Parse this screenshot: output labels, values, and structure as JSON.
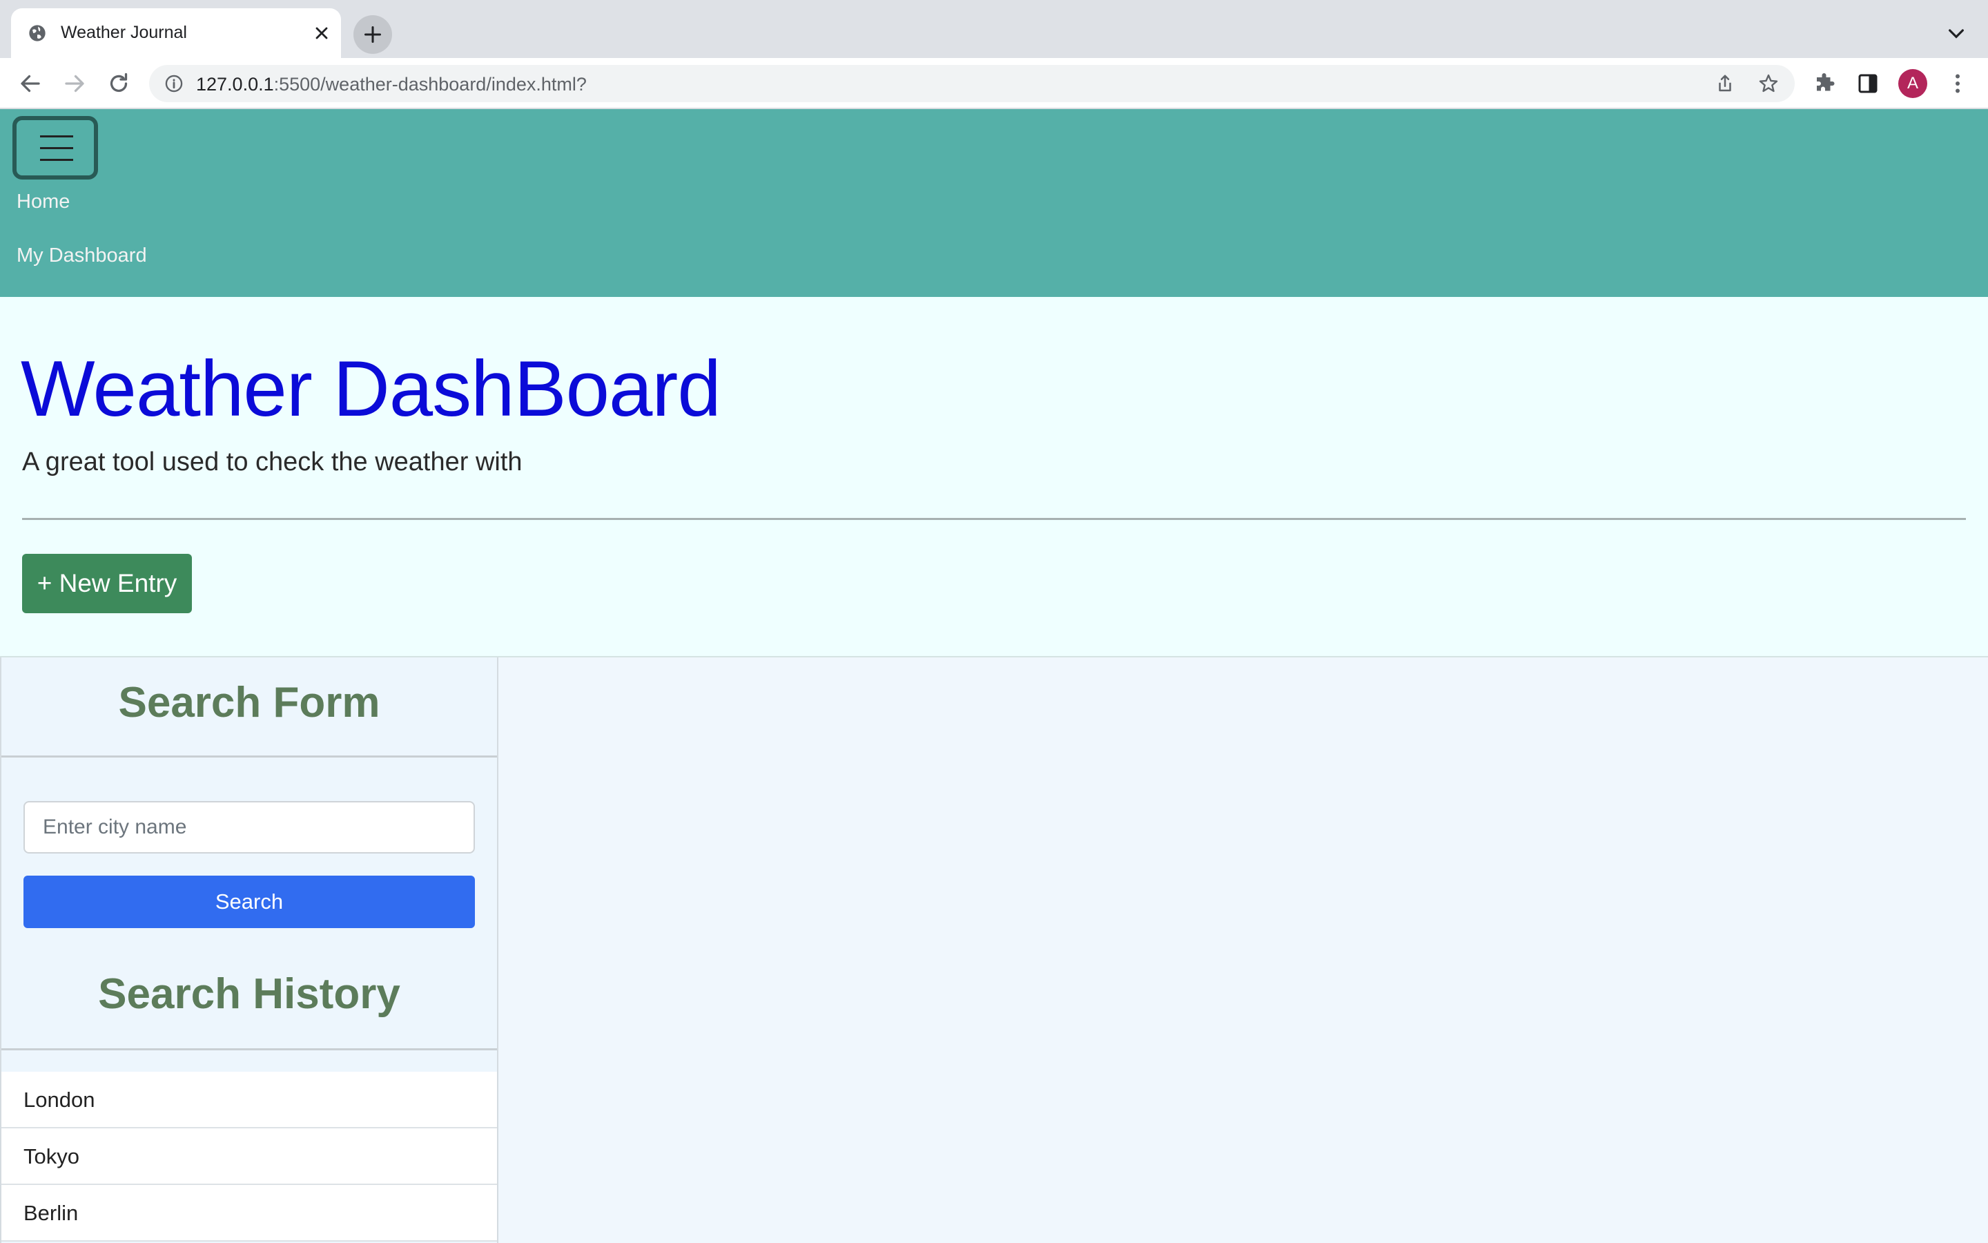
{
  "browser": {
    "tab_title": "Weather Journal",
    "url_host": "127.0.0.1",
    "url_rest": ":5500/weather-dashboard/index.html?",
    "avatar_letter": "A"
  },
  "navbar": {
    "links": [
      "Home",
      "My Dashboard"
    ]
  },
  "hero": {
    "title": "Weather DashBoard",
    "lead": "A great tool used to check the weather with",
    "new_entry_label": "+ New Entry"
  },
  "search_form": {
    "title": "Search Form",
    "placeholder": "Enter city name",
    "button_label": "Search"
  },
  "search_history": {
    "title": "Search History",
    "items": [
      "London",
      "Tokyo",
      "Berlin"
    ]
  },
  "colors": {
    "navbar": "#55b0a8",
    "hero_title": "#0b0bd8",
    "new_entry": "#3d8a5b",
    "search_button": "#316cf0",
    "section_title": "#5c7c5a"
  }
}
